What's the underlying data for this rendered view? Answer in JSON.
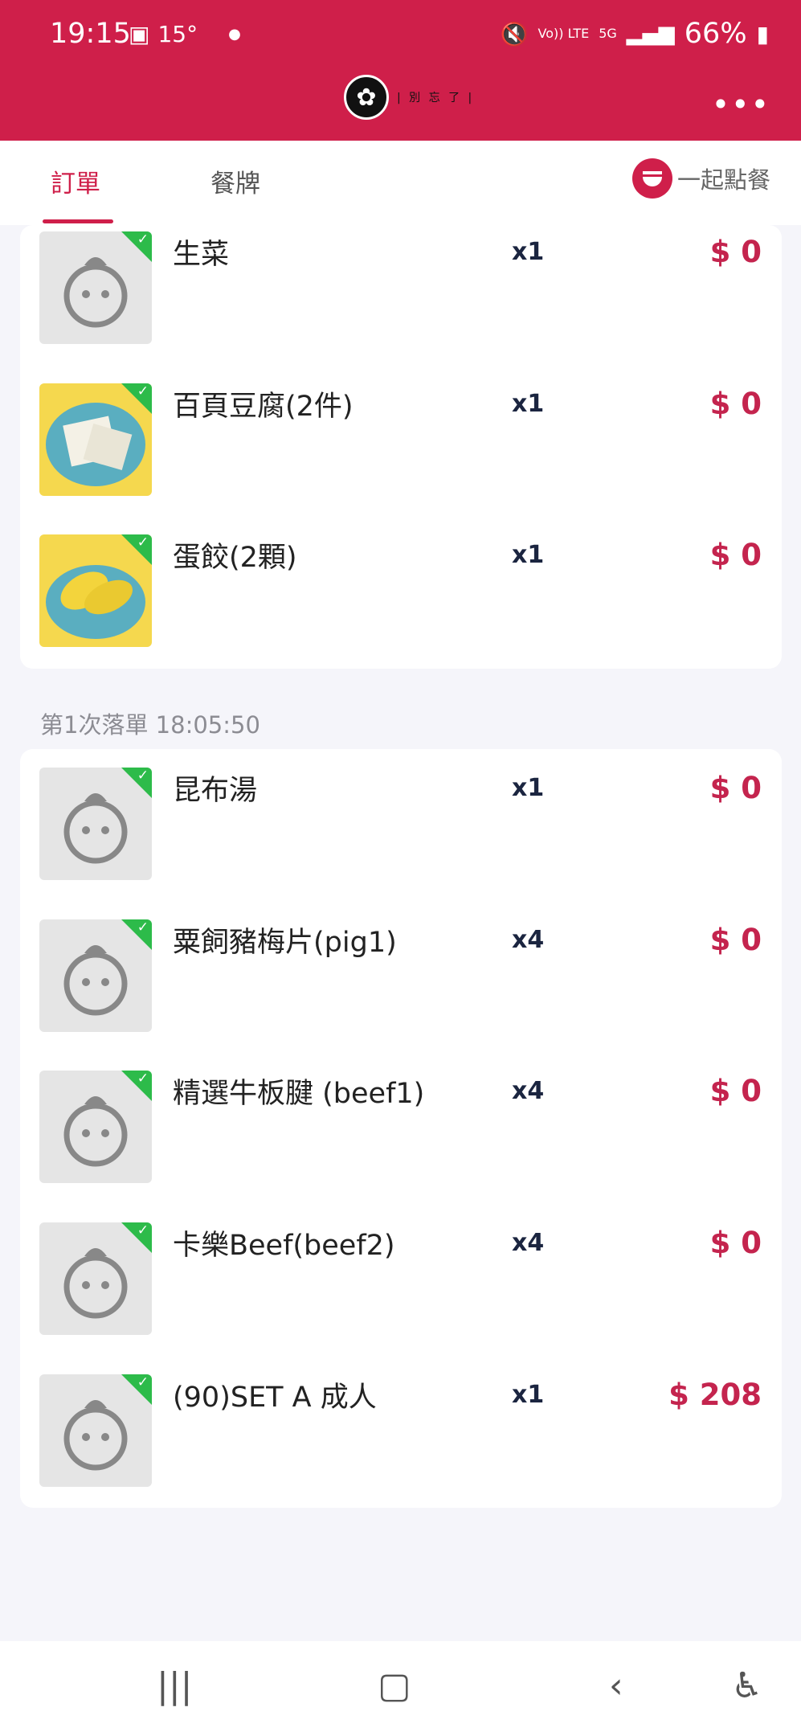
{
  "status_bar": {
    "time": "19:15",
    "temperature": "15°",
    "network_label": "Vo)) LTE",
    "network_gen": "5G",
    "battery": "66%"
  },
  "tabs": {
    "active_label": "訂單",
    "other_label": "餐牌",
    "order_together": "一起點餐"
  },
  "colors": {
    "brand": "#cf1f4a",
    "check": "#2dbb4a",
    "price": "#c4244e"
  },
  "first_group": {
    "items": [
      {
        "name": "生菜",
        "qty": "x1",
        "price": "$ 0",
        "image": "placeholder"
      },
      {
        "name": "百頁豆腐(2件)",
        "qty": "x1",
        "price": "$ 0",
        "image": "tofu-photo"
      },
      {
        "name": "蛋餃(2顆)",
        "qty": "x1",
        "price": "$ 0",
        "image": "egg-dumpling-photo"
      }
    ]
  },
  "second_group": {
    "header": "第1次落單 18:05:50",
    "items": [
      {
        "name": "昆布湯",
        "qty": "x1",
        "price": "$ 0",
        "image": "placeholder"
      },
      {
        "name": "粟飼豬梅片(pig1)",
        "qty": "x4",
        "price": "$ 0",
        "image": "placeholder"
      },
      {
        "name": "精選牛板腱 (beef1)",
        "qty": "x4",
        "price": "$ 0",
        "image": "placeholder"
      },
      {
        "name": "卡樂Beef(beef2)",
        "qty": "x4",
        "price": "$ 0",
        "image": "placeholder"
      },
      {
        "name": "(90)SET A 成人",
        "qty": "x1",
        "price": "$ 208",
        "image": "placeholder"
      }
    ]
  },
  "icons": {
    "more": "more-dots-icon",
    "bowl": "bowl-icon",
    "check": "check-icon",
    "mascot": "mascot-placeholder-icon"
  }
}
